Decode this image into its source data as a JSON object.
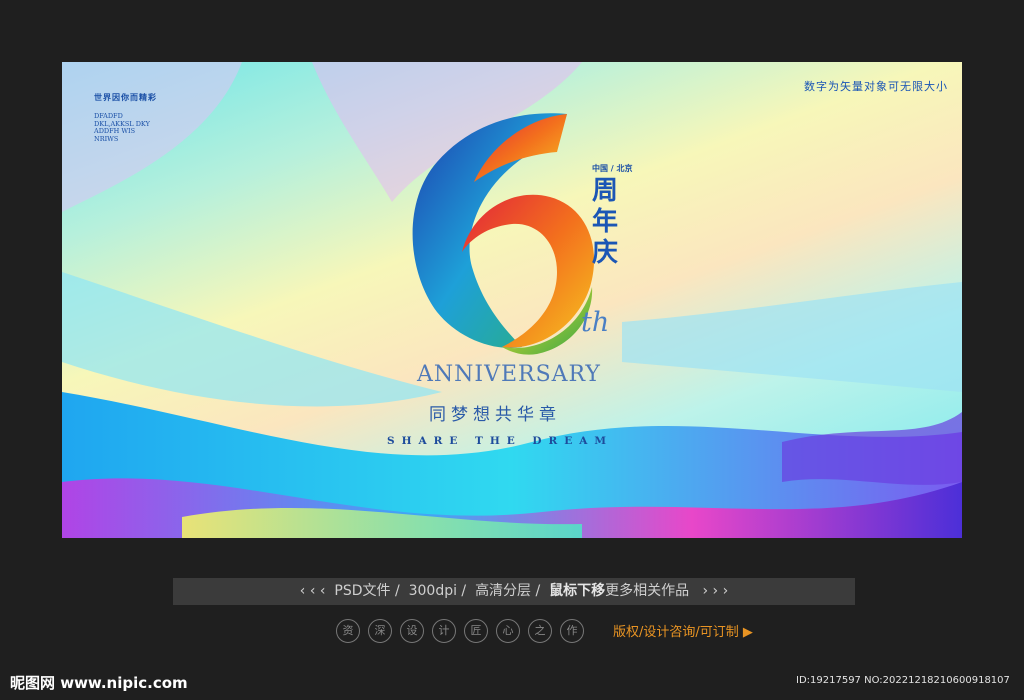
{
  "poster": {
    "top_left_cn": "世界因你而精彩",
    "top_left_en": "DFADFD\nDKL,AKKSL DKY\nADDFH WIS\nNRIWS",
    "top_right": "数字为矢量对象可无限大小",
    "number_mark": "6",
    "city": "中国 / 北京",
    "zhou": "周年庆",
    "suffix": "th",
    "anniversary": "ANNIVERSARY",
    "tagline_cn": "同梦想共华章",
    "tagline_en": "SHARE THE DREAM"
  },
  "nav": {
    "prev": "‹ ‹ ‹",
    "psd": "PSD文件 /",
    "dpi": "300dpi /",
    "layers": "高清分层 /",
    "hint_bold": "鼠标下移",
    "hint": "更多相关作品",
    "next": "› › ›"
  },
  "badges": [
    "资",
    "深",
    "设",
    "计",
    "匠",
    "心",
    "之",
    "作"
  ],
  "copyright": "版权/设计咨询/可订制 ▶",
  "footer": {
    "logo": "昵图网 www.nipic.com",
    "id": "ID:19217597 NO:20221218210600918107"
  }
}
